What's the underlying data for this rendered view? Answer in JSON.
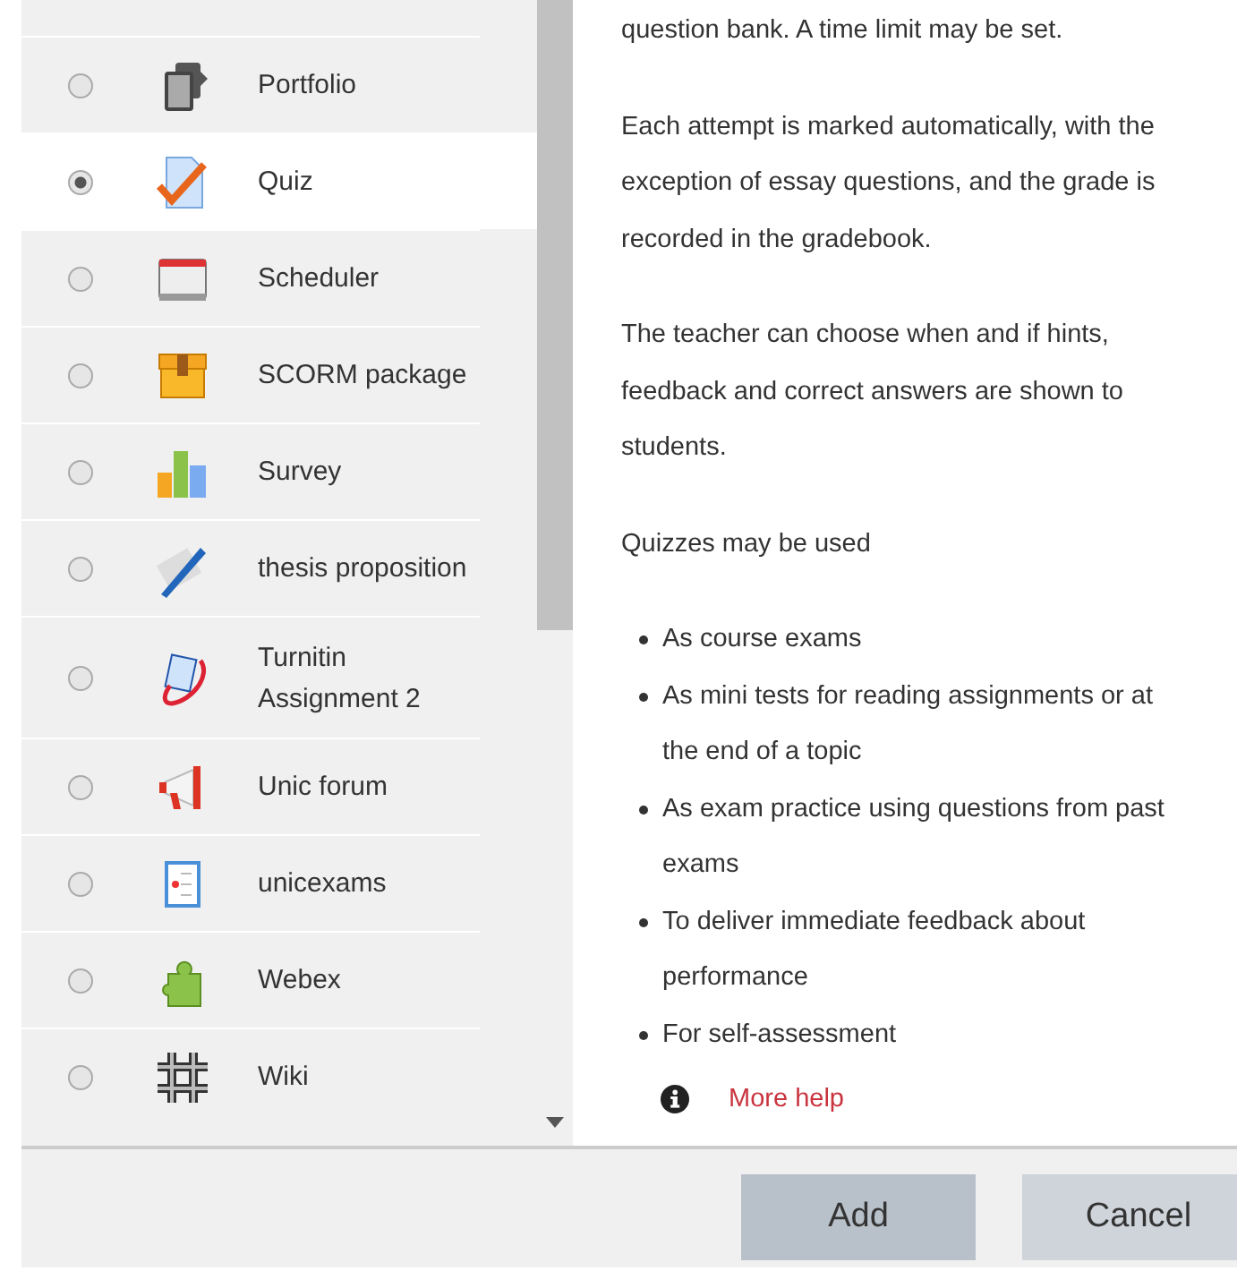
{
  "activities": [
    {
      "label": "Portfolio",
      "kind": "portfolio",
      "selected": false
    },
    {
      "label": "Quiz",
      "kind": "quiz",
      "selected": true
    },
    {
      "label": "Scheduler",
      "kind": "scheduler",
      "selected": false
    },
    {
      "label": "SCORM package",
      "kind": "scorm",
      "selected": false
    },
    {
      "label": "Survey",
      "kind": "survey",
      "selected": false
    },
    {
      "label": "thesis proposition",
      "kind": "thesis",
      "selected": false
    },
    {
      "label": "Turnitin Assignment 2",
      "kind": "turnitin",
      "selected": false
    },
    {
      "label": "Unic forum",
      "kind": "forum",
      "selected": false
    },
    {
      "label": "unicexams",
      "kind": "exams",
      "selected": false
    },
    {
      "label": "Webex",
      "kind": "webex",
      "selected": false
    },
    {
      "label": "Wiki",
      "kind": "wiki",
      "selected": false
    }
  ],
  "help": {
    "paragraphs": [
      "question bank. A time limit may be set.",
      "Each attempt is marked automatically, with the exception of essay questions, and the grade is recorded in the gradebook.",
      "The teacher can choose when and if hints, feedback and correct answers are shown to students.",
      "Quizzes may be used"
    ],
    "bullets": [
      "As course exams",
      "As mini tests for reading assignments or at the end of a topic",
      "As exam practice using questions from past exams",
      "To deliver immediate feedback about performance",
      "For self-assessment"
    ],
    "more_help": "More help"
  },
  "buttons": [
    {
      "label": "Add",
      "kind": "primary"
    },
    {
      "label": "Cancel",
      "kind": "secondary"
    }
  ]
}
